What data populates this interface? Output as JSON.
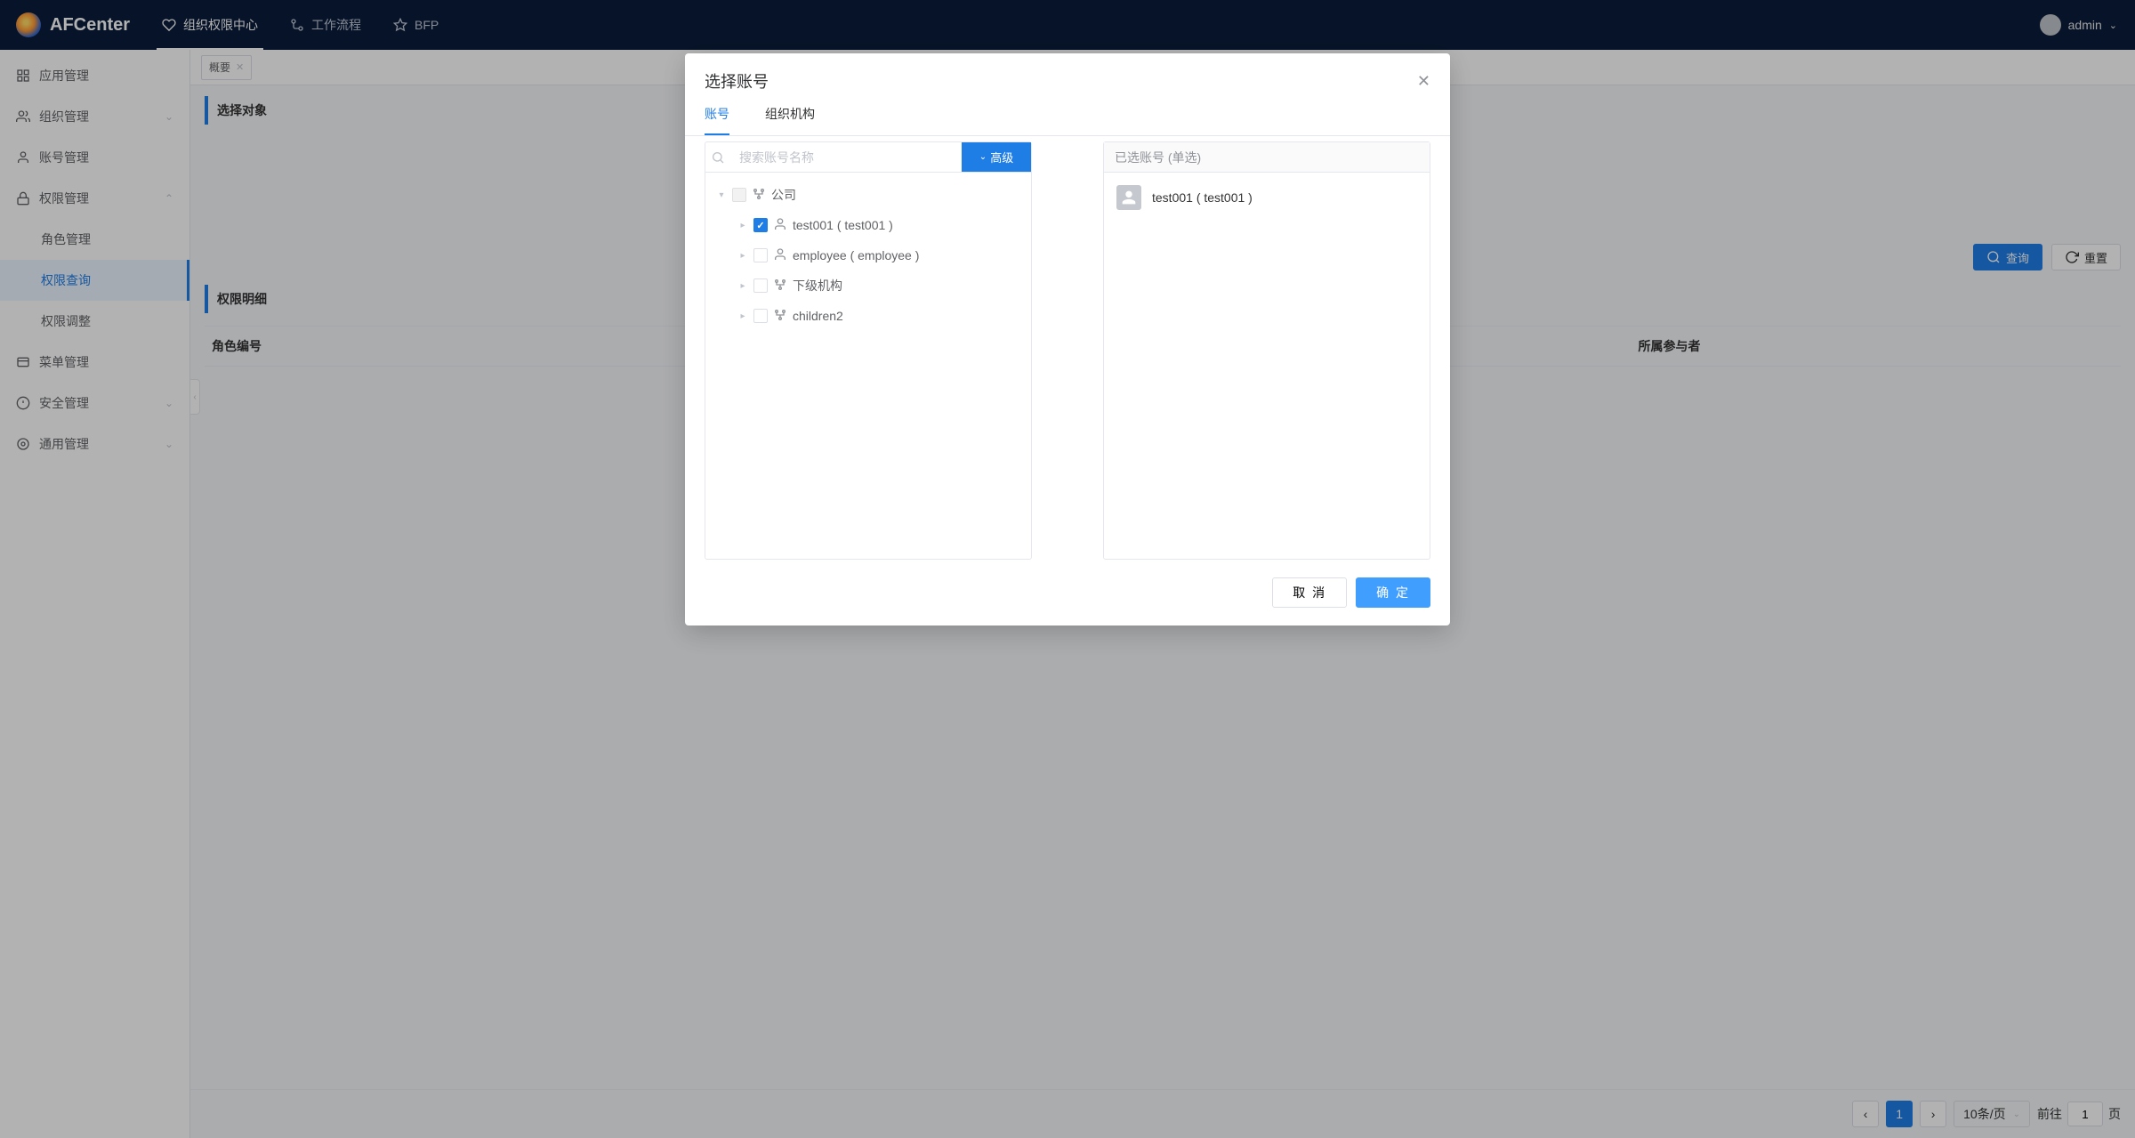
{
  "app": {
    "name": "AFCenter",
    "user": "admin"
  },
  "topnav": [
    {
      "label": "组织权限中心"
    },
    {
      "label": "工作流程"
    },
    {
      "label": "BFP"
    }
  ],
  "sidebar": {
    "items": [
      {
        "label": "应用管理",
        "expandable": false
      },
      {
        "label": "组织管理",
        "expandable": true
      },
      {
        "label": "账号管理",
        "expandable": false
      },
      {
        "label": "权限管理",
        "expandable": true,
        "children": [
          {
            "label": "角色管理"
          },
          {
            "label": "权限查询",
            "active": true
          },
          {
            "label": "权限调整"
          }
        ]
      },
      {
        "label": "菜单管理",
        "expandable": false
      },
      {
        "label": "安全管理",
        "expandable": true
      },
      {
        "label": "通用管理",
        "expandable": true
      }
    ]
  },
  "tabs": [
    {
      "label": "概要"
    }
  ],
  "page": {
    "section1": "选择对象",
    "section2": "权限明细",
    "columns": {
      "code": "角色编号",
      "owner": "所属参与者"
    },
    "buttons": {
      "query": "查询",
      "reset": "重置"
    }
  },
  "pager": {
    "page_size": "10条/页",
    "goto_prefix": "前往",
    "goto_suffix": "页",
    "current": "1"
  },
  "dialog": {
    "title": "选择账号",
    "tabs": {
      "account": "账号",
      "org": "组织机构"
    },
    "search_placeholder": "搜索账号名称",
    "adv": "高级",
    "panel_right_title": "已选账号 (单选)",
    "tree": [
      {
        "label": "公司",
        "type": "org",
        "checkable": false,
        "expand": "open"
      },
      {
        "label": "test001 ( test001 )",
        "type": "user",
        "checked": true,
        "child": true,
        "expand": "closed"
      },
      {
        "label": "employee ( employee )",
        "type": "user",
        "checked": false,
        "child": true,
        "expand": "closed"
      },
      {
        "label": "下级机构",
        "type": "org",
        "checked": false,
        "child": true,
        "expand": "closed"
      },
      {
        "label": "children2",
        "type": "org",
        "checked": false,
        "child": true,
        "expand": "closed"
      }
    ],
    "selected": {
      "label": "test001 ( test001 )"
    },
    "cancel": "取 消",
    "confirm": "确 定"
  }
}
